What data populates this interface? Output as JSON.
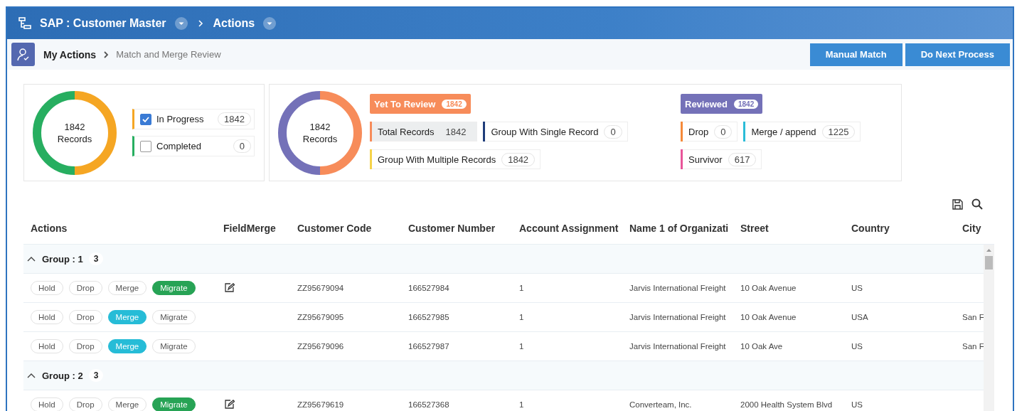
{
  "header": {
    "crumbs": [
      "SAP : Customer Master",
      "Actions"
    ]
  },
  "breadcrumb": {
    "title": "My Actions",
    "current": "Match and Merge Review"
  },
  "buttons": [
    "Manual Match",
    "Do Next Process"
  ],
  "status_card": {
    "donut": {
      "value": "1842",
      "caption": "Records"
    },
    "items": [
      {
        "label": "In Progress",
        "count": "1842",
        "checked": true,
        "color": "#f5a623"
      },
      {
        "label": "Completed",
        "count": "0",
        "checked": false,
        "color": "#27ae60"
      }
    ]
  },
  "review_card": {
    "donut": {
      "value": "1842",
      "caption": "Records"
    },
    "sections": [
      {
        "label": "Yet To Review",
        "count": "1842",
        "color": "#f78c5a",
        "rows": [
          {
            "items": [
              {
                "label": "Total Records",
                "count": "1842",
                "color": "#f78c5a",
                "selected": true
              },
              {
                "label": "Group With Single Record",
                "count": "0",
                "color": "#1f3d7a",
                "selected": false
              }
            ]
          },
          {
            "items": [
              {
                "label": "Group With Multiple Records",
                "count": "1842",
                "color": "#f5d34a",
                "selected": false
              }
            ]
          }
        ]
      },
      {
        "label": "Reviewed",
        "count": "1842",
        "color": "#7471b8",
        "rows": [
          {
            "items": [
              {
                "label": "Drop",
                "count": "0",
                "color": "#f58a3a",
                "selected": false
              },
              {
                "label": "Merge / append",
                "count": "1225",
                "color": "#2bbcd8",
                "selected": false
              }
            ]
          },
          {
            "items": [
              {
                "label": "Survivor",
                "count": "617",
                "color": "#e8559a",
                "selected": false
              }
            ]
          }
        ]
      }
    ]
  },
  "table": {
    "columns": [
      "Actions",
      "FieldMerge",
      "Customer Code",
      "Customer Number",
      "Account Assignment",
      "Name 1 of Organizati",
      "Street",
      "Country",
      "City"
    ],
    "groups": [
      {
        "label": "Group : 1",
        "count": "3",
        "expanded": true,
        "rows": [
          {
            "actions": [
              {
                "label": "Hold",
                "selected": false
              },
              {
                "label": "Drop",
                "selected": false
              },
              {
                "label": "Merge",
                "selected": false
              },
              {
                "label": "Migrate",
                "selected": true
              }
            ],
            "field_merge": true,
            "cells": [
              "ZZ95679094",
              "166527984",
              "1",
              "Jarvis International Freight",
              "10 Oak Avenue",
              "US"
            ]
          },
          {
            "actions": [
              {
                "label": "Hold",
                "selected": false
              },
              {
                "label": "Drop",
                "selected": false
              },
              {
                "label": "Merge",
                "selected": true
              },
              {
                "label": "Migrate",
                "selected": false
              }
            ],
            "field_merge": false,
            "cells": [
              "ZZ95679095",
              "166527985",
              "1",
              "Jarvis International Freight",
              "10 Oak Avenue",
              "USA",
              "San F"
            ]
          },
          {
            "actions": [
              {
                "label": "Hold",
                "selected": false
              },
              {
                "label": "Drop",
                "selected": false
              },
              {
                "label": "Merge",
                "selected": true
              },
              {
                "label": "Migrate",
                "selected": false
              }
            ],
            "field_merge": false,
            "cells": [
              "ZZ95679096",
              "166527987",
              "1",
              "Jarvis International Freight",
              "10 Oak Ave",
              "US",
              "San F"
            ]
          }
        ]
      },
      {
        "label": "Group : 2",
        "count": "3",
        "expanded": true,
        "rows": [
          {
            "actions": [
              {
                "label": "Hold",
                "selected": false
              },
              {
                "label": "Drop",
                "selected": false
              },
              {
                "label": "Merge",
                "selected": false
              },
              {
                "label": "Migrate",
                "selected": true
              }
            ],
            "field_merge": true,
            "cells": [
              "ZZ95679619",
              "166527368",
              "1",
              "Converteam, Inc.",
              "2000 Health System Blvd",
              "US"
            ]
          }
        ]
      }
    ]
  }
}
